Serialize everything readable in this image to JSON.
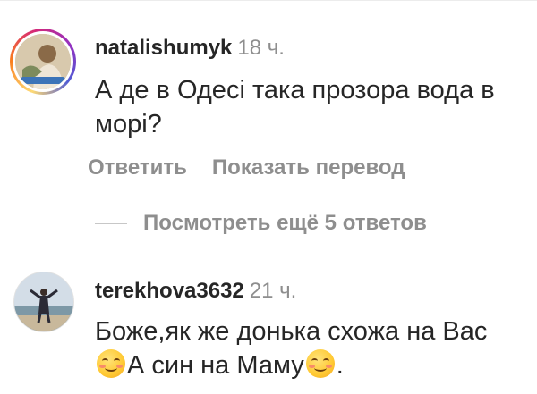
{
  "comments": [
    {
      "username": "natalishumyk",
      "time": "18 ч.",
      "text": "А де в Одесі така прозора вода в морі?",
      "actions": {
        "reply": "Ответить",
        "translate": "Показать перевод"
      },
      "avatar_story_ring": true
    },
    {
      "username": "terekhova3632",
      "time": "21 ч.",
      "text_part1": "Боже,як же донька схожа на Вас",
      "text_part2": "А син на Маму",
      "text_part3": ".",
      "emoji_1": "smiling-face-with-smiling-eyes-emoji",
      "emoji_2": "relieved-face-emoji"
    }
  ],
  "view_more_replies": "Посмотреть ещё 5 ответов"
}
